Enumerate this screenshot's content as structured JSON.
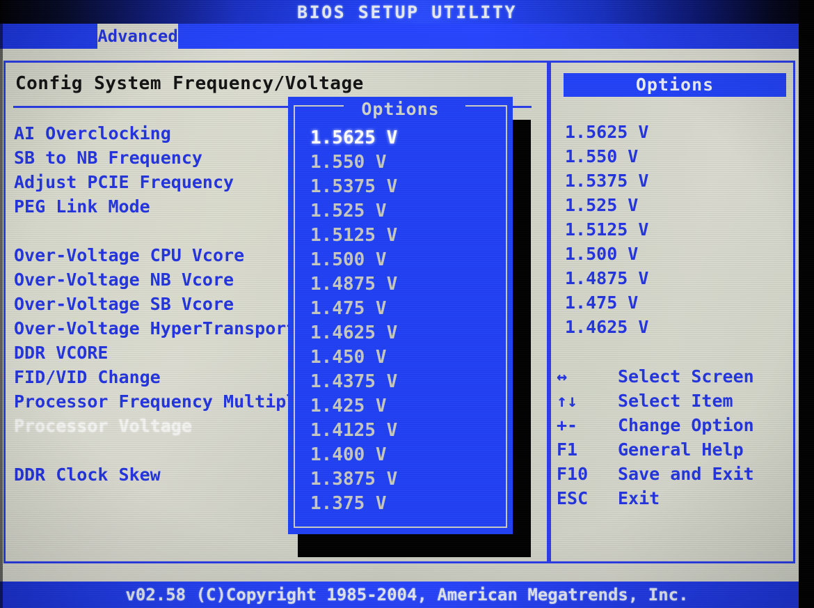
{
  "header": {
    "title": "BIOS SETUP UTILITY",
    "tabs": [
      {
        "label": "Advanced",
        "active": true
      }
    ]
  },
  "left_panel": {
    "section_title": "Config System Frequency/Voltage",
    "items": [
      {
        "label": "AI Overclocking",
        "selected": false
      },
      {
        "label": "SB to NB Frequency",
        "selected": false
      },
      {
        "label": "Adjust PCIE Frequency",
        "selected": false
      },
      {
        "label": "PEG Link Mode",
        "selected": false
      },
      {
        "label": "",
        "selected": false
      },
      {
        "label": "Over-Voltage CPU Vcore",
        "selected": false
      },
      {
        "label": "Over-Voltage NB Vcore",
        "selected": false
      },
      {
        "label": "Over-Voltage SB Vcore",
        "selected": false
      },
      {
        "label": "Over-Voltage HyperTransport",
        "selected": false
      },
      {
        "label": "DDR VCORE",
        "selected": false
      },
      {
        "label": "FID/VID Change",
        "selected": false
      },
      {
        "label": "Processor Frequency Multipl",
        "selected": false
      },
      {
        "label": "Processor Voltage",
        "selected": true
      },
      {
        "label": "",
        "selected": false
      },
      {
        "label": "DDR Clock Skew",
        "selected": false
      }
    ]
  },
  "popup": {
    "title": "Options",
    "options": [
      {
        "label": "1.5625 V",
        "selected": true
      },
      {
        "label": "1.550 V",
        "selected": false
      },
      {
        "label": "1.5375 V",
        "selected": false
      },
      {
        "label": "1.525 V",
        "selected": false
      },
      {
        "label": "1.5125 V",
        "selected": false
      },
      {
        "label": "1.500 V",
        "selected": false
      },
      {
        "label": "1.4875 V",
        "selected": false
      },
      {
        "label": "1.475 V",
        "selected": false
      },
      {
        "label": "1.4625 V",
        "selected": false
      },
      {
        "label": "1.450 V",
        "selected": false
      },
      {
        "label": "1.4375 V",
        "selected": false
      },
      {
        "label": "1.425 V",
        "selected": false
      },
      {
        "label": "1.4125 V",
        "selected": false
      },
      {
        "label": "1.400 V",
        "selected": false
      },
      {
        "label": "1.3875 V",
        "selected": false
      },
      {
        "label": "1.375 V",
        "selected": false
      }
    ]
  },
  "right_panel": {
    "options_header": "Options",
    "values": [
      "1.5625 V",
      "1.550 V",
      "1.5375 V",
      "1.525 V",
      "1.5125 V",
      "1.500 V",
      "1.4875 V",
      "1.475 V",
      "1.4625 V"
    ],
    "help_keys": [
      {
        "key": "↔",
        "label": "Select Screen"
      },
      {
        "key": "↑↓",
        "label": "Select Item"
      },
      {
        "key": "+-",
        "label": "Change Option"
      },
      {
        "key": "F1",
        "label": "General Help"
      },
      {
        "key": "F10",
        "label": "Save and Exit"
      },
      {
        "key": "ESC",
        "label": "Exit"
      }
    ]
  },
  "footer": {
    "text": "v02.58 (C)Copyright 1985-2004, American Megatrends, Inc."
  },
  "colors": {
    "screen_bg": "#d6d6cc",
    "accent_blue": "#2233dd",
    "bar_blue": "#2744ff",
    "selected_text": "#ffffff",
    "title_black": "#121212",
    "popup_bg": "#2040f4",
    "popup_dim_text": "#c6c8c0"
  }
}
